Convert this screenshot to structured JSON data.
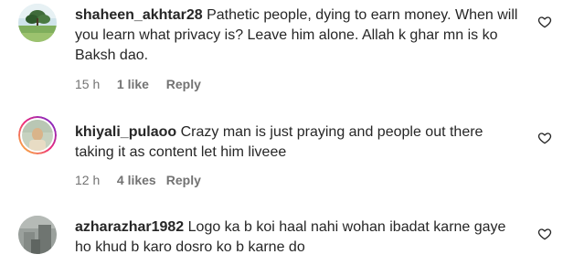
{
  "comments": [
    {
      "username": "shaheen_akhtar28",
      "text": "Pathetic people, dying to earn money. When will you learn what privacy is? Leave him alone. Allah k ghar mn is ko Baksh dao.",
      "time": "15 h",
      "likes": "1 like",
      "reply": "Reply",
      "avatar_icon": "landscape-avatar",
      "heart_icon": "heart-outline-icon"
    },
    {
      "username": "khiyali_pulaoo",
      "text": "Crazy man is just praying and people out there taking it as content let him liveee",
      "time": "12 h",
      "likes": "4 likes",
      "reply": "Reply",
      "avatar_icon": "story-ring-avatar",
      "heart_icon": "heart-outline-icon"
    },
    {
      "username": "azharazhar1982",
      "text": "Logo ka b koi haal nahi wohan ibadat karne gaye ho khud b karo dosro ko b karne do",
      "avatar_icon": "photo-avatar",
      "heart_icon": "heart-outline-icon"
    }
  ],
  "colors": {
    "text": "#262626",
    "meta": "#737373",
    "story_ring_start": "#f9ce34",
    "story_ring_mid": "#ee2a7b",
    "story_ring_end": "#6228d7"
  }
}
